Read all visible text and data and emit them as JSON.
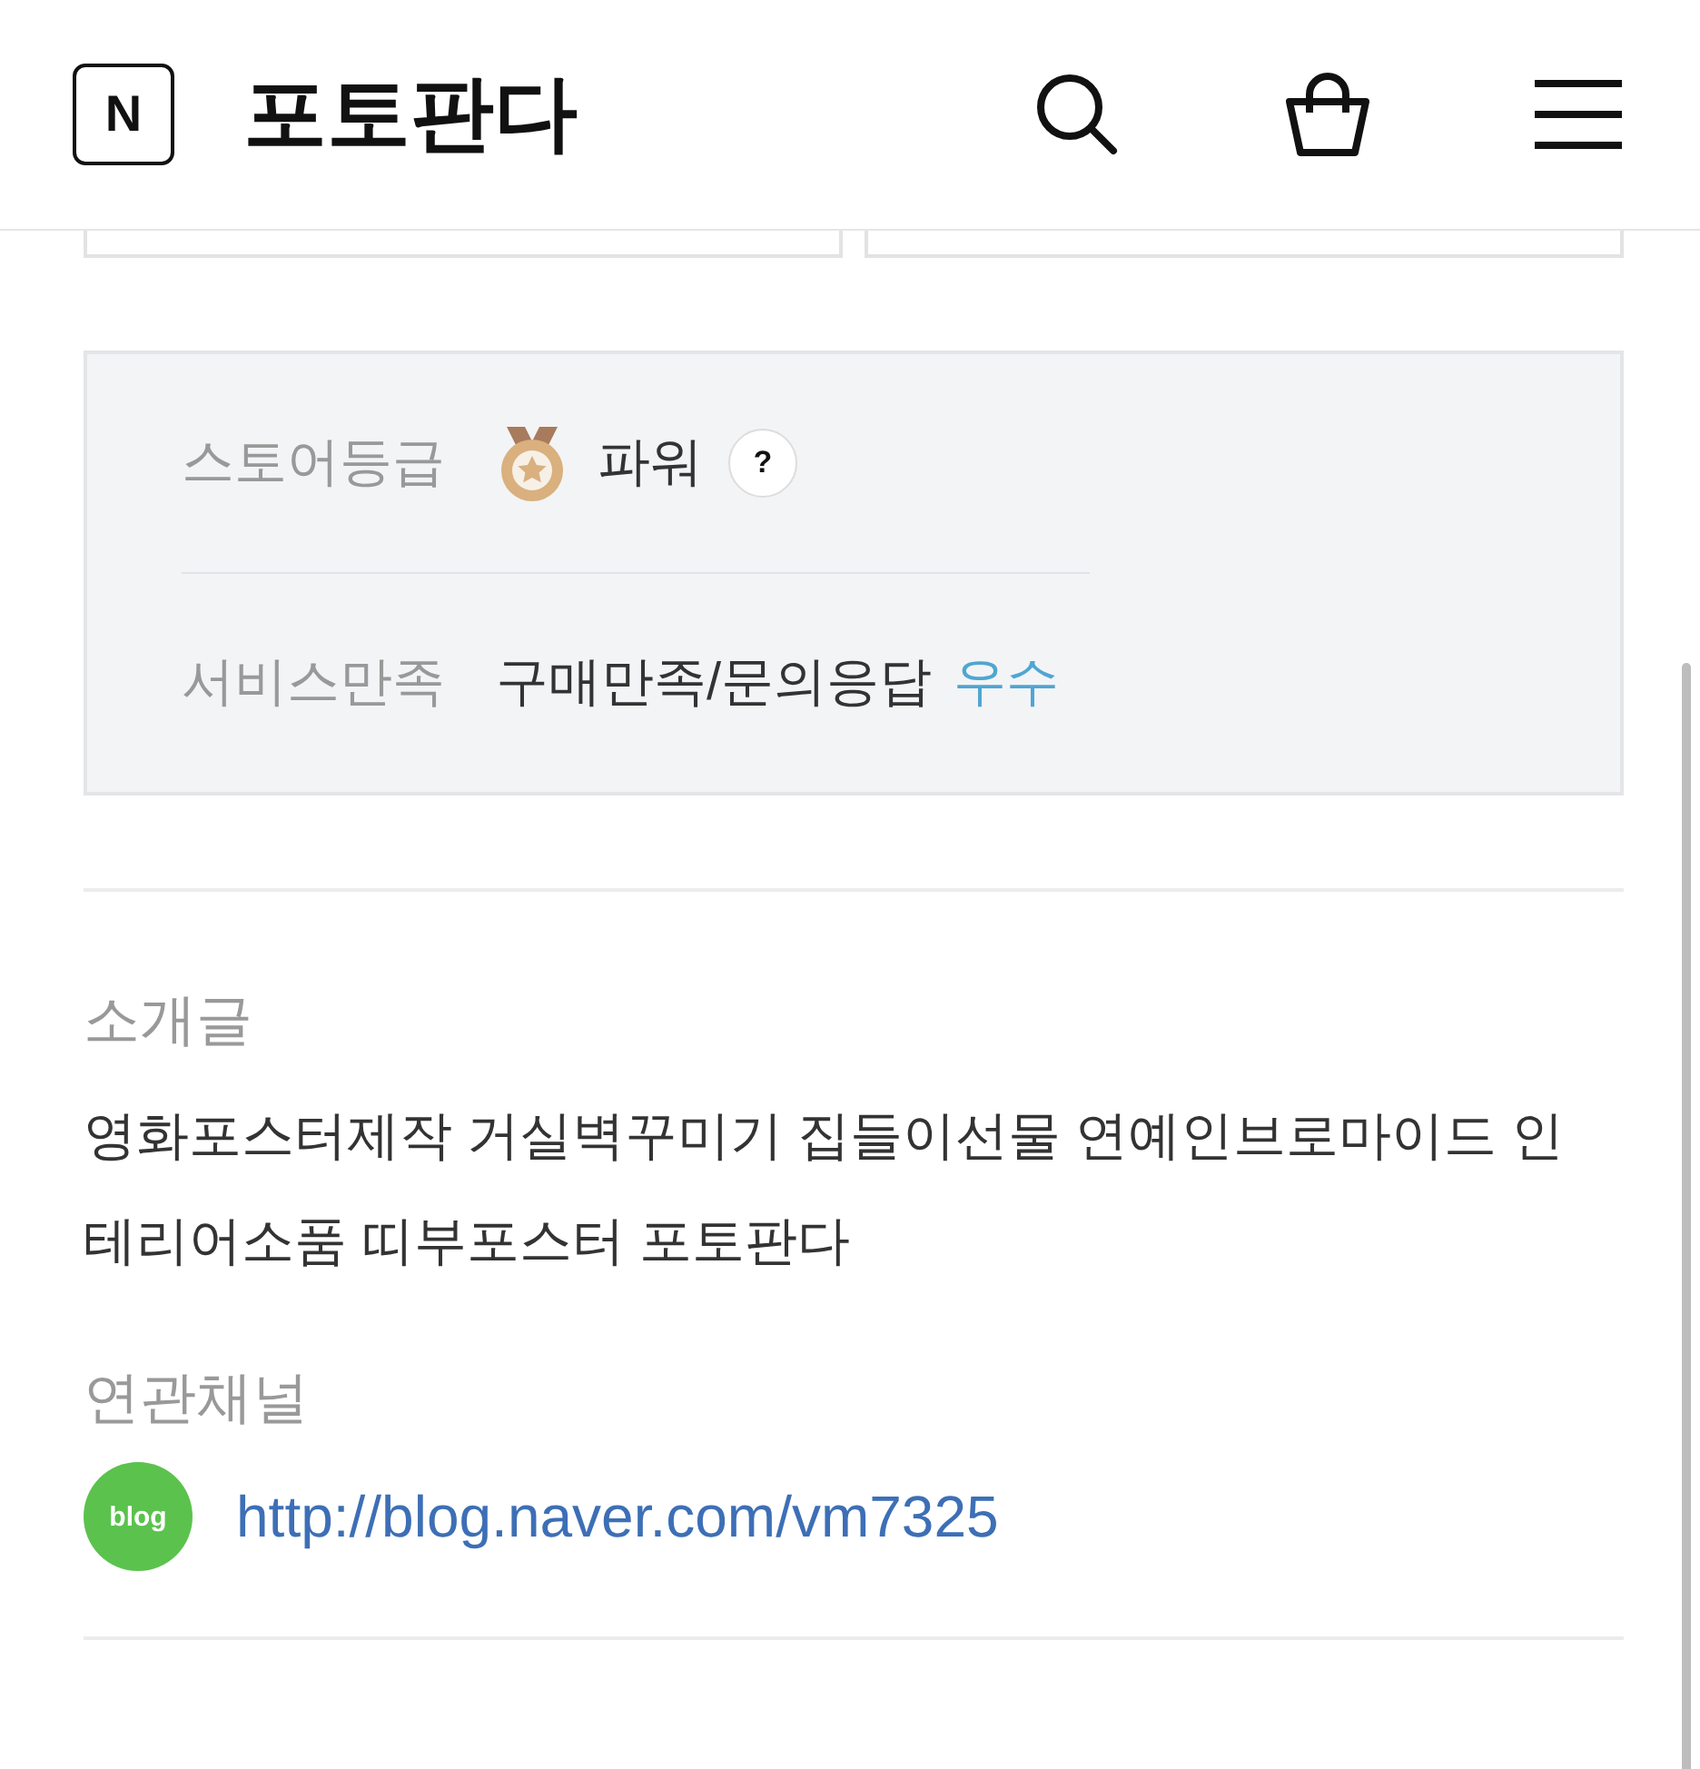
{
  "header": {
    "logo": "N",
    "title": "포토판다"
  },
  "store_info": {
    "rows": [
      {
        "kind": "grade",
        "label": "스토어등급",
        "value": "파워",
        "help": "?"
      },
      {
        "kind": "service",
        "label": "서비스만족",
        "value": "구매만족/문의응답",
        "grade": "우수"
      }
    ]
  },
  "intro": {
    "label": "소개글",
    "text": "영화포스터제작 거실벽꾸미기 집들이선물 연예인브로마이드 인테리어소품 띠부포스터 포토판다"
  },
  "channels": {
    "label": "연관채널",
    "items": [
      {
        "badge": "blog",
        "url": "http://blog.naver.com/vm7325"
      }
    ]
  }
}
